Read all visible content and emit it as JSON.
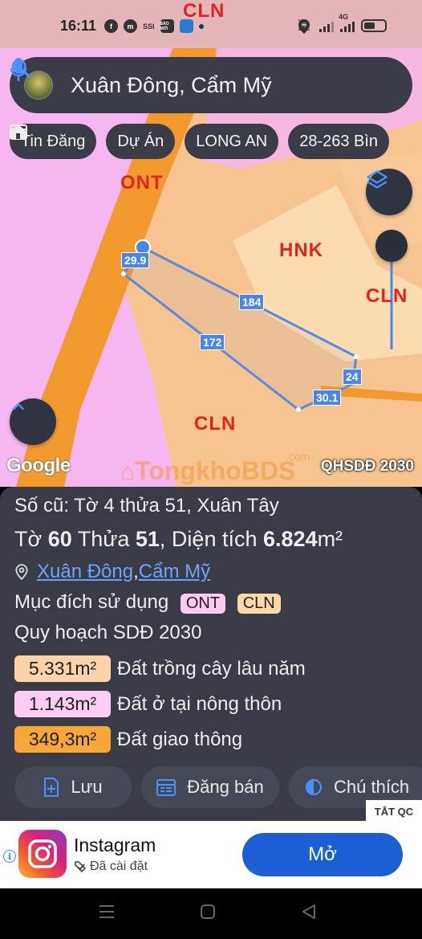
{
  "status_bar": {
    "time": "16:11",
    "icons": [
      "facebook-icon",
      "messenger-icon",
      "ssi-icon",
      "news-icon",
      "browser-icon",
      "dot-icon"
    ],
    "left_texts": [
      "SSI",
      "BÁO MỚI"
    ],
    "right_icons": [
      "location-icon",
      "volte-icon",
      "signal-icon",
      "4g-signal-icon",
      "battery-icon"
    ],
    "volte_label": "Vo LTE",
    "network_label": "4G",
    "battery_level": 0.55
  },
  "search": {
    "text": "Xuân Đông, Cẩm Mỹ"
  },
  "chips": [
    {
      "label": "Tin Đăng",
      "icon": "calendar-icon"
    },
    {
      "label": "Dự Án",
      "icon": "house-icon"
    },
    {
      "label": "LONG AN",
      "icon": ""
    },
    {
      "label": "28-263 Bìn",
      "icon": ""
    }
  ],
  "map": {
    "labels": {
      "ont": "ONT",
      "hnk": "HNK",
      "cln_right": "CLN",
      "cln_bottom": "CLN",
      "cln_top": "CLN"
    },
    "dimensions": {
      "d1": "29.9",
      "d2": "184",
      "d3": "172",
      "d4": "24",
      "d5": "30.1"
    },
    "google": "Google",
    "watermark": "TongkhoBDS",
    "watermark_suffix": ".com",
    "overlay_label": "QHSDĐ 2030",
    "colors": {
      "ont_pink": "#f6b6f0",
      "cln_orange": "#f7c48f",
      "hnk_light": "#fcdcb0",
      "road": "#f39a2e",
      "plot_line": "#5b8ae0"
    }
  },
  "panel": {
    "old_ref": "Số cũ: Tờ 4 thửa 51, Xuân Tây",
    "sheet_prefix": "Tờ ",
    "sheet_num": "60",
    "parcel_prefix": " Thửa ",
    "parcel_num": "51",
    "area_prefix": ", Diện tích ",
    "area_value": "6.824",
    "area_unit": "m²",
    "location_commune": "Xuân Đông",
    "location_sep": ", ",
    "location_district": "Cẩm Mỹ",
    "purpose_label": "Mục đích sử dụng",
    "purpose_badges": [
      "ONT",
      "CLN"
    ],
    "plan_label": "Quy hoạch SDĐ 2030",
    "areas": [
      {
        "value": "5.331m²",
        "label": "Đất trồng cây lâu năm",
        "color": "#ffd2a8"
      },
      {
        "value": "1.143m²",
        "label": "Đất ở tại nông thôn",
        "color": "#ffccf4"
      },
      {
        "value": "349,3m²",
        "label": "Đất giao thông",
        "color": "#f7a63a"
      }
    ],
    "buttons": {
      "save": "Lưu",
      "post": "Đăng bán",
      "legend": "Chú thích"
    },
    "hide_ads": "TẮT QC"
  },
  "ad": {
    "title": "Instagram",
    "subtitle": "Đã cài đặt",
    "button": "Mở",
    "info_glyph": "i"
  }
}
